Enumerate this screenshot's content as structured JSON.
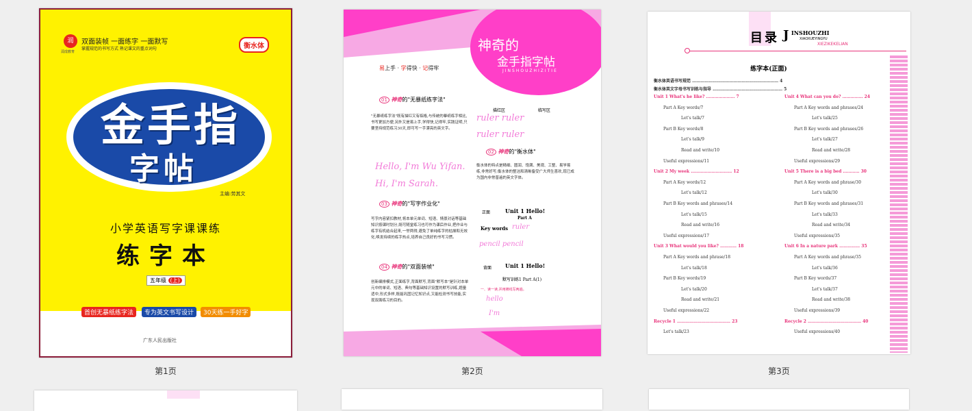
{
  "pages": [
    {
      "caption": "第1页",
      "brand_line1": "双面装帧 一面练字 一面默写",
      "brand_line2": "掌握规范的书写方式  熟记课文的重点词句",
      "brand_name": "润成教育",
      "badge": "衡水体",
      "title_big": "金手指",
      "title_sub": "字帖",
      "author": "主编:劳其文",
      "subtitle": "小学英语写字课课练",
      "book_type": "练字本",
      "grade": "五年级",
      "term": "上",
      "tags": [
        "首创无暴纸练字法",
        "专为英文书写设计",
        "30天练一手好字"
      ],
      "publisher": "广东人民出版社"
    },
    {
      "caption": "第2页",
      "banner_title_1": "神奇的",
      "banner_title_2": "金手指字帖",
      "banner_pinyin": "JINSHOUZHIZITIE",
      "slogan_1": "易",
      "slogan_1b": "上手 · ",
      "slogan_2": "学",
      "slogan_2b": "得快 · ",
      "slogan_3": "记",
      "slogan_3b": "得牢",
      "sections": [
        {
          "num": "01",
          "head": "神奇",
          "tail": "的\"无暴纸练字法\""
        },
        {
          "num": "02",
          "head": "神奇",
          "tail": "的\"衡水体\""
        },
        {
          "num": "03",
          "head": "神奇",
          "tail": "的\"写字作业化\""
        },
        {
          "num": "04",
          "head": "神奇",
          "tail": "的\"双面装帧\""
        }
      ],
      "text_1": "\"无暴纸练字法\"既有描红又有临格,与传统的摹纸练字相比,书写更加方便,另外又是易上手,学得快,记得牢,实践证明,只要坚持规范练习30天,即可写一手漂亮的英文字。",
      "text_2": "衡水体的特点是精细、圆润、饱满、美观、工整、易学易练,非常好写;衡水体的整洁和清晰备受广大师生喜欢,现已成为国内非常普遍的英文字体。",
      "text_3": "写字内容紧扣教材,将本单元单词、短语、情景对话等基础知识按课时划分,既可随堂练习也可作为课后作业,把作业与练字有机结合起来,一举两得,避免了单纯练字的枯燥和无效化,唤发持续的练字热点,培养自己良好的书写习惯。",
      "text_4": "创新编排模式,正面练字,背面默写,背面\"默写本\"是针对本单元中的单词、短语、典句等基础知识设置的默写训练,题量适中,形式多样,既能巩固记忆知识点,又能检测书写技能,实现双面练习的目的。",
      "col_a": "描红区",
      "col_b": "临写区",
      "hw_1": "ruler  ruler",
      "hw_2": "ruler  ruler",
      "hw_3": "Hello, I'm Wu Yifan.",
      "hw_4": "Hi, I'm Sarah.",
      "front_label": "正面",
      "back_label": "背面",
      "unit_title": "Unit 1  Hello!",
      "part_a": "Part A",
      "key_words": "Key words",
      "kw_1": "ruler",
      "kw_2": "pencil  pencil",
      "drill": "默写训练1  Part A(1)",
      "drill_hint": "一、读一读,并用横线写两遍。",
      "hw_5": "hello",
      "hw_6": "I'm"
    },
    {
      "caption": "第3页",
      "toc_title": "目录",
      "toc_pinyin_big": "J",
      "toc_pinyin_1": "INSHOUZHI",
      "toc_pinyin_2": "XIAOXUEYINGYU",
      "toc_pinyin_3": "XIEZIKEKELIAN",
      "section_title": "练字本(正面)",
      "intro_1": "衡水体英语书写规范 ……………………………………………………… 4",
      "intro_2": "衡水体英文字母书写训练与指导 …………………………………………… 5",
      "left_col": [
        {
          "t": "Unit 1   What's he like? ………………… 7",
          "u": true
        },
        {
          "t": "Part A   Key words/7"
        },
        {
          "t": "Let's talk/7",
          "i": 2
        },
        {
          "t": "Part B   Key words/8"
        },
        {
          "t": "Let's talk/9",
          "i": 2
        },
        {
          "t": "Read and write/10",
          "i": 2
        },
        {
          "t": "Useful expressions/11",
          "i": 1
        },
        {
          "t": "Unit 2   My week ………………………… 12",
          "u": true
        },
        {
          "t": "Part A   Key words/12"
        },
        {
          "t": "Let's talk/12",
          "i": 2
        },
        {
          "t": "Part B   Key words and phrases/14"
        },
        {
          "t": "Let's talk/15",
          "i": 2
        },
        {
          "t": "Read and write/16",
          "i": 2
        },
        {
          "t": "Useful expressions/17",
          "i": 1
        },
        {
          "t": "Unit 3   What would you like? ………… 18",
          "u": true
        },
        {
          "t": "Part A   Key words and phrase/18"
        },
        {
          "t": "Let's talk/18",
          "i": 2
        },
        {
          "t": "Part B   Key words/19"
        },
        {
          "t": "Let's talk/20",
          "i": 2
        },
        {
          "t": "Read and write/21",
          "i": 2
        },
        {
          "t": "Useful expressions/22",
          "i": 1
        },
        {
          "t": "Recycle 1 ………………………………… 23",
          "u": true
        },
        {
          "t": "Let's talk/23",
          "i": 1
        }
      ],
      "right_col": [
        {
          "t": "Unit 4   What can you do? …………… 24",
          "u": true
        },
        {
          "t": "Part A   Key words and phrases/24"
        },
        {
          "t": "Let's talk/25",
          "i": 2
        },
        {
          "t": "Part B   Key words and phrases/26"
        },
        {
          "t": "Let's talk/27",
          "i": 2
        },
        {
          "t": "Read and write/28",
          "i": 2
        },
        {
          "t": "Useful expressions/29",
          "i": 1
        },
        {
          "t": "Unit 5   There is a big bed ………… 30",
          "u": true
        },
        {
          "t": "Part A   Key words and phrase/30"
        },
        {
          "t": "Let's talk/30",
          "i": 2
        },
        {
          "t": "Part B   Key words and phrases/31"
        },
        {
          "t": "Let's talk/33",
          "i": 2
        },
        {
          "t": "Read and write/34",
          "i": 2
        },
        {
          "t": "Useful expressions/35",
          "i": 1
        },
        {
          "t": "Unit 6   In a nature park …………… 35",
          "u": true
        },
        {
          "t": "Part A   Key words and phrase/35"
        },
        {
          "t": "Let's talk/36",
          "i": 2
        },
        {
          "t": "Part B   Key words/37"
        },
        {
          "t": "Let's talk/37",
          "i": 2
        },
        {
          "t": "Read and write/38",
          "i": 2
        },
        {
          "t": "Useful expressions/39",
          "i": 1
        },
        {
          "t": "Recycle 2 ………………………………… 40",
          "u": true
        },
        {
          "t": "Useful expressions/40",
          "i": 1
        }
      ]
    }
  ],
  "colors": {
    "accent_pink": "#ff3fc8",
    "cover_yellow": "#fff200",
    "selected_border": "#8b1d3a",
    "toc_pink": "#e8337a"
  }
}
